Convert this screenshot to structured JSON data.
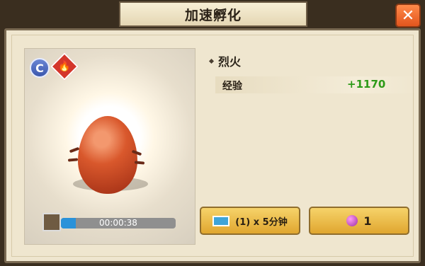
{
  "dialog": {
    "title": "加速孵化",
    "close_label": "✕"
  },
  "pet": {
    "rank": "C",
    "element_symbol": "🔥",
    "name": "烈火",
    "exp_label": "经验",
    "exp_value": "+1170"
  },
  "progress": {
    "time_left": "00:00:38",
    "fill_fraction": 0.13
  },
  "actions": {
    "ticket_label": "(1) x 5分钟",
    "gem_cost": "1"
  }
}
